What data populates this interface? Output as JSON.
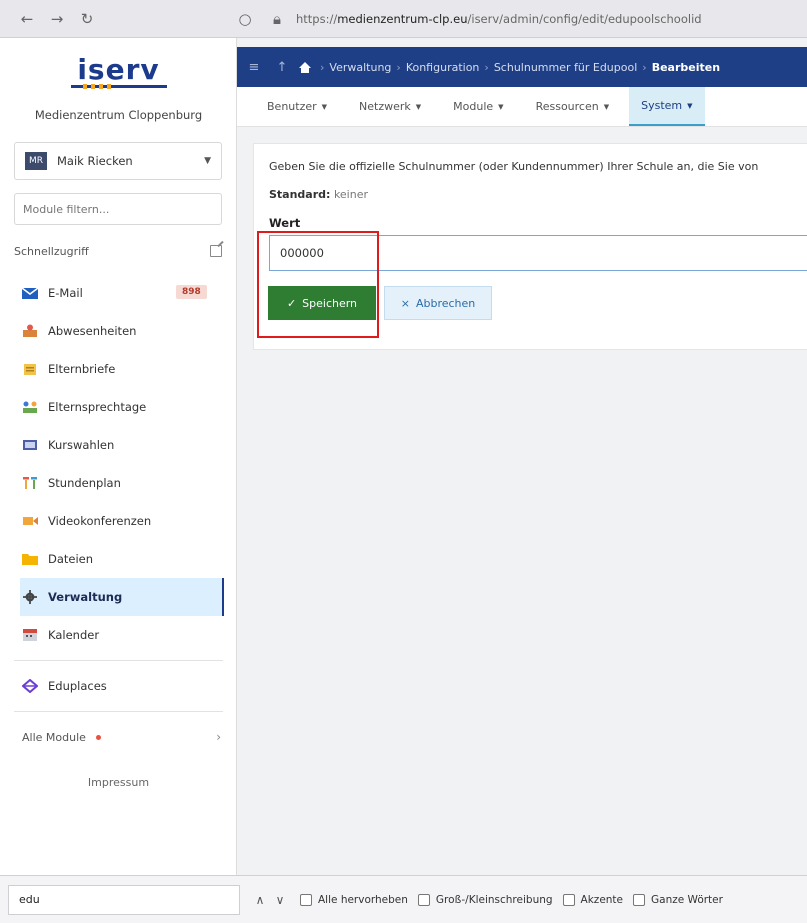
{
  "browser": {
    "url_prefix": "https://",
    "url_domain": "medienzentrum-clp.eu",
    "url_path": "/iserv/admin/config/edit/edupoolschoolid"
  },
  "sidebar": {
    "logo": "iserv",
    "org": "Medienzentrum Cloppenburg",
    "user_initials": "MR",
    "user_name": "Maik Riecken",
    "filter_placeholder": "Module filtern...",
    "quick_access": "Schnellzugriff",
    "items": [
      {
        "label": "E-Mail",
        "icon": "mail-icon",
        "badge": "898"
      },
      {
        "label": "Abwesenheiten",
        "icon": "absence-icon"
      },
      {
        "label": "Elternbriefe",
        "icon": "letter-icon"
      },
      {
        "label": "Elternsprechtage",
        "icon": "meeting-icon"
      },
      {
        "label": "Kurswahlen",
        "icon": "course-icon"
      },
      {
        "label": "Stundenplan",
        "icon": "timetable-icon"
      },
      {
        "label": "Videokonferenzen",
        "icon": "video-icon"
      },
      {
        "label": "Dateien",
        "icon": "folder-icon"
      },
      {
        "label": "Verwaltung",
        "icon": "gear-icon"
      },
      {
        "label": "Kalender",
        "icon": "calendar-icon"
      }
    ],
    "eduplaces": "Eduplaces",
    "all_modules": "Alle Module",
    "impressum": "Impressum"
  },
  "breadcrumb": {
    "items": [
      "Verwaltung",
      "Konfiguration",
      "Schulnummer für Edupool",
      "Bearbeiten"
    ]
  },
  "tabs": [
    "Benutzer",
    "Netzwerk",
    "Module",
    "Ressourcen",
    "System"
  ],
  "form": {
    "description": "Geben Sie die offizielle Schulnummer (oder Kundennummer) Ihrer Schule an, die Sie von",
    "default_label": "Standard:",
    "default_value": "keiner",
    "value_label": "Wert",
    "value": "000000",
    "save": "Speichern",
    "cancel": "Abbrechen"
  },
  "findbar": {
    "query": "edu",
    "highlight_all": "Alle hervorheben",
    "match_case": "Groß-/Kleinschreibung",
    "accents": "Akzente",
    "whole_words": "Ganze Wörter"
  },
  "colors": {
    "brand": "#1e3f86",
    "save": "#2e7d32",
    "highlight": "#e01b1b"
  }
}
